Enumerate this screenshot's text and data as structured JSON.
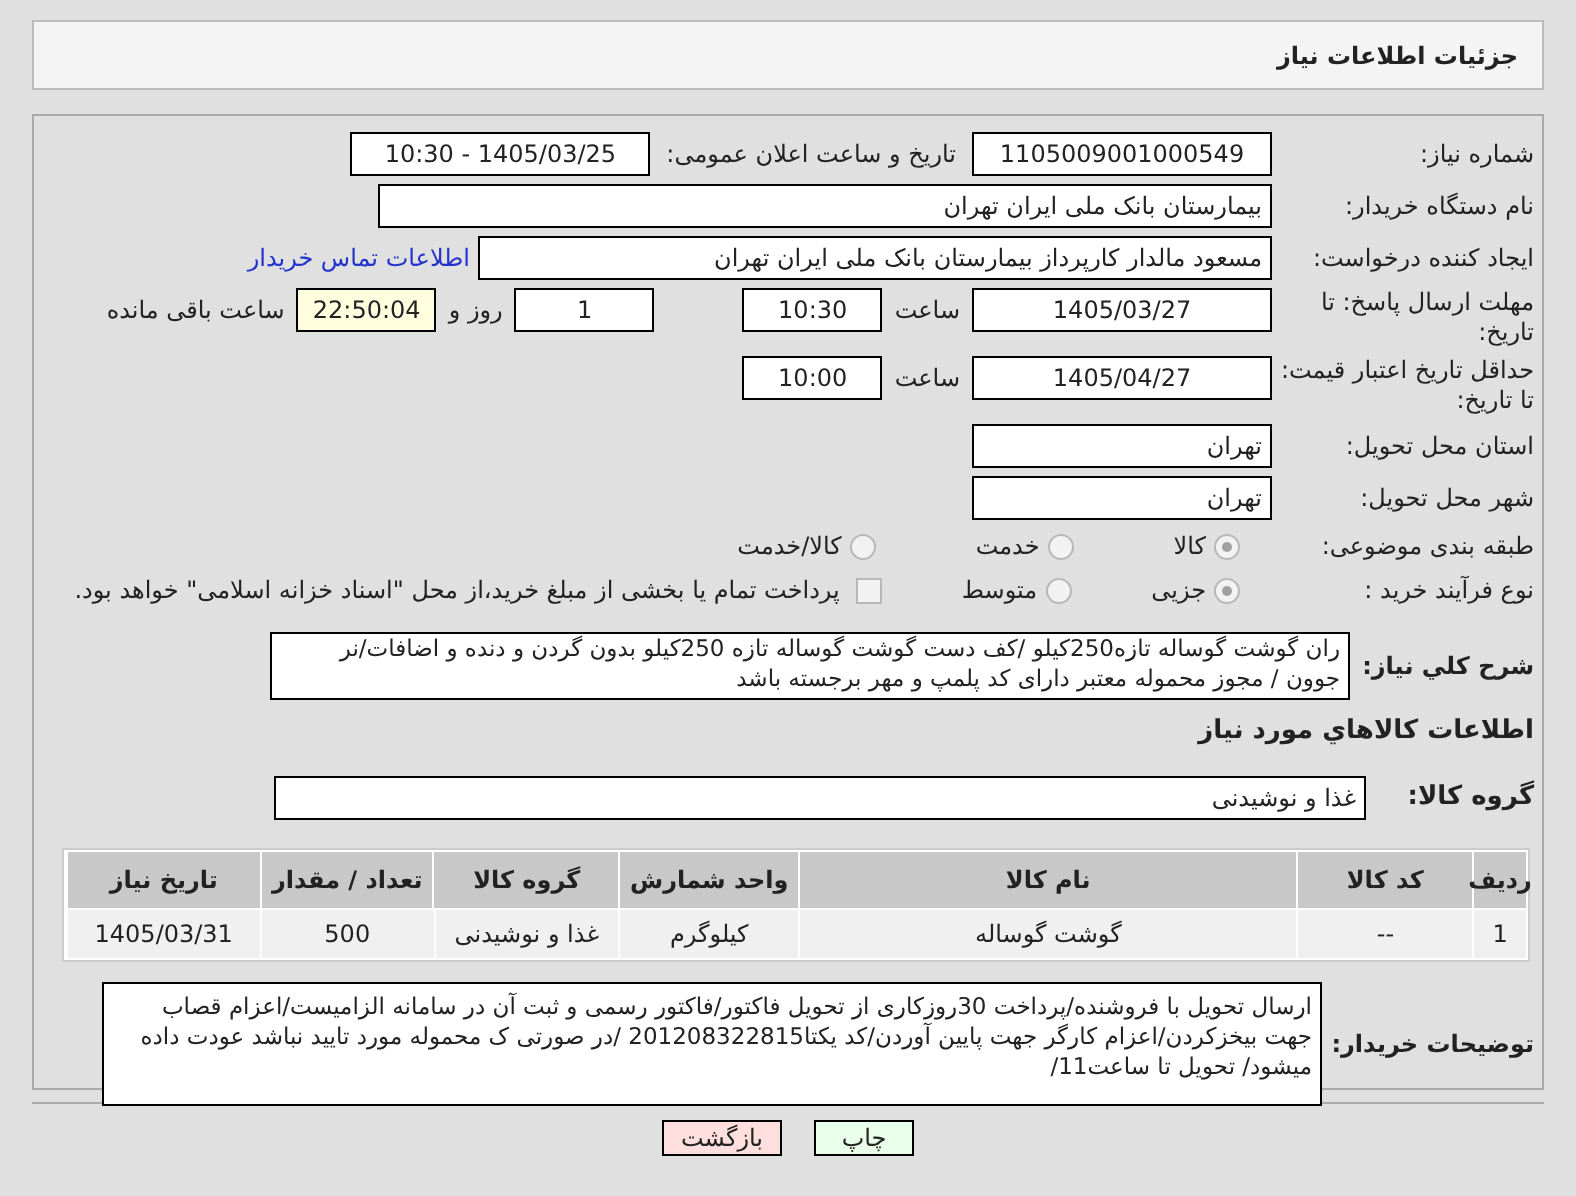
{
  "page_title": "جزئیات اطلاعات نیاز",
  "need_number": {
    "label": "شماره نیاز:",
    "value": "1105009001000549"
  },
  "announce": {
    "label": "تاریخ و ساعت اعلان عمومی:",
    "value": "1405/03/25 - 10:30"
  },
  "buyer_org": {
    "label": "نام دستگاه خریدار:",
    "value": "بیمارستان بانک ملی ایران تهران"
  },
  "requester": {
    "label": "ایجاد کننده درخواست:",
    "value": "مسعود مالدار کارپرداز بیمارستان بانک ملی ایران تهران",
    "link": "اطلاعات تماس خریدار"
  },
  "deadline": {
    "label": "مهلت ارسال پاسخ: تا تاریخ:",
    "date": "1405/03/27",
    "time_label": "ساعت",
    "time": "10:30",
    "days": "1",
    "days_label": "روز و",
    "remaining": "22:50:04",
    "remaining_label": "ساعت باقی مانده"
  },
  "validity": {
    "label": "حداقل تاریخ اعتبار قیمت: تا تاریخ:",
    "date": "1405/04/27",
    "time_label": "ساعت",
    "time": "10:00"
  },
  "province": {
    "label": "استان محل تحویل:",
    "value": "تهران"
  },
  "city": {
    "label": "شهر محل تحویل:",
    "value": "تهران"
  },
  "category": {
    "label": "طبقه بندی موضوعی:",
    "options": [
      {
        "label": "کالا",
        "selected": true
      },
      {
        "label": "خدمت",
        "selected": false
      },
      {
        "label": "کالا/خدمت",
        "selected": false
      }
    ]
  },
  "purchase_type": {
    "label": "نوع فرآیند خرید :",
    "options": [
      {
        "label": "جزیی",
        "selected": true
      },
      {
        "label": "متوسط",
        "selected": false
      }
    ],
    "payment_option": {
      "label": "پرداخت تمام یا بخشی از مبلغ خرید،از محل \"اسناد خزانه اسلامی\" خواهد بود.",
      "checked": false
    }
  },
  "description": {
    "label": "شرح کلي نياز:",
    "value": "ران گوشت گوساله تازه250کیلو /کف دست گوشت گوساله تازه 250کیلو بدون گردن و دنده و اضافات/نر جوون / مجوز محموله معتبر دارای کد پلمپ و مهر برجسته باشد"
  },
  "goods_section_title": "اطلاعات کالاهاي مورد نياز",
  "goods_group": {
    "label": "گروه کالا:",
    "value": "غذا و نوشیدنی"
  },
  "table": {
    "columns": [
      "ردیف",
      "کد کالا",
      "نام کالا",
      "واحد شمارش",
      "گروه کالا",
      "تعداد / مقدار",
      "تاریخ نیاز"
    ],
    "rows": [
      [
        "1",
        "--",
        "گوشت گوساله",
        "کیلوگرم",
        "غذا و نوشیدنی",
        "500",
        "1405/03/31"
      ]
    ]
  },
  "buyer_notes": {
    "label": "توضیحات خریدار:",
    "value": "ارسال تحویل با فروشنده/پرداخت 30روزکاری از تحویل فاکتور/فاکتور رسمی و ثبت آن در سامانه الزامیست/اعزام قصاب جهت بیخزکردن/اعزام کارگر جهت پایین آوردن/کد یکتا201208322815 /در صورتی ک محموله مورد تایید نباشد عودت داده میشود/ تحویل تا ساعت11/"
  },
  "buttons": [
    {
      "kind": "print",
      "label": "چاپ"
    },
    {
      "kind": "back",
      "label": "بازگشت"
    }
  ]
}
